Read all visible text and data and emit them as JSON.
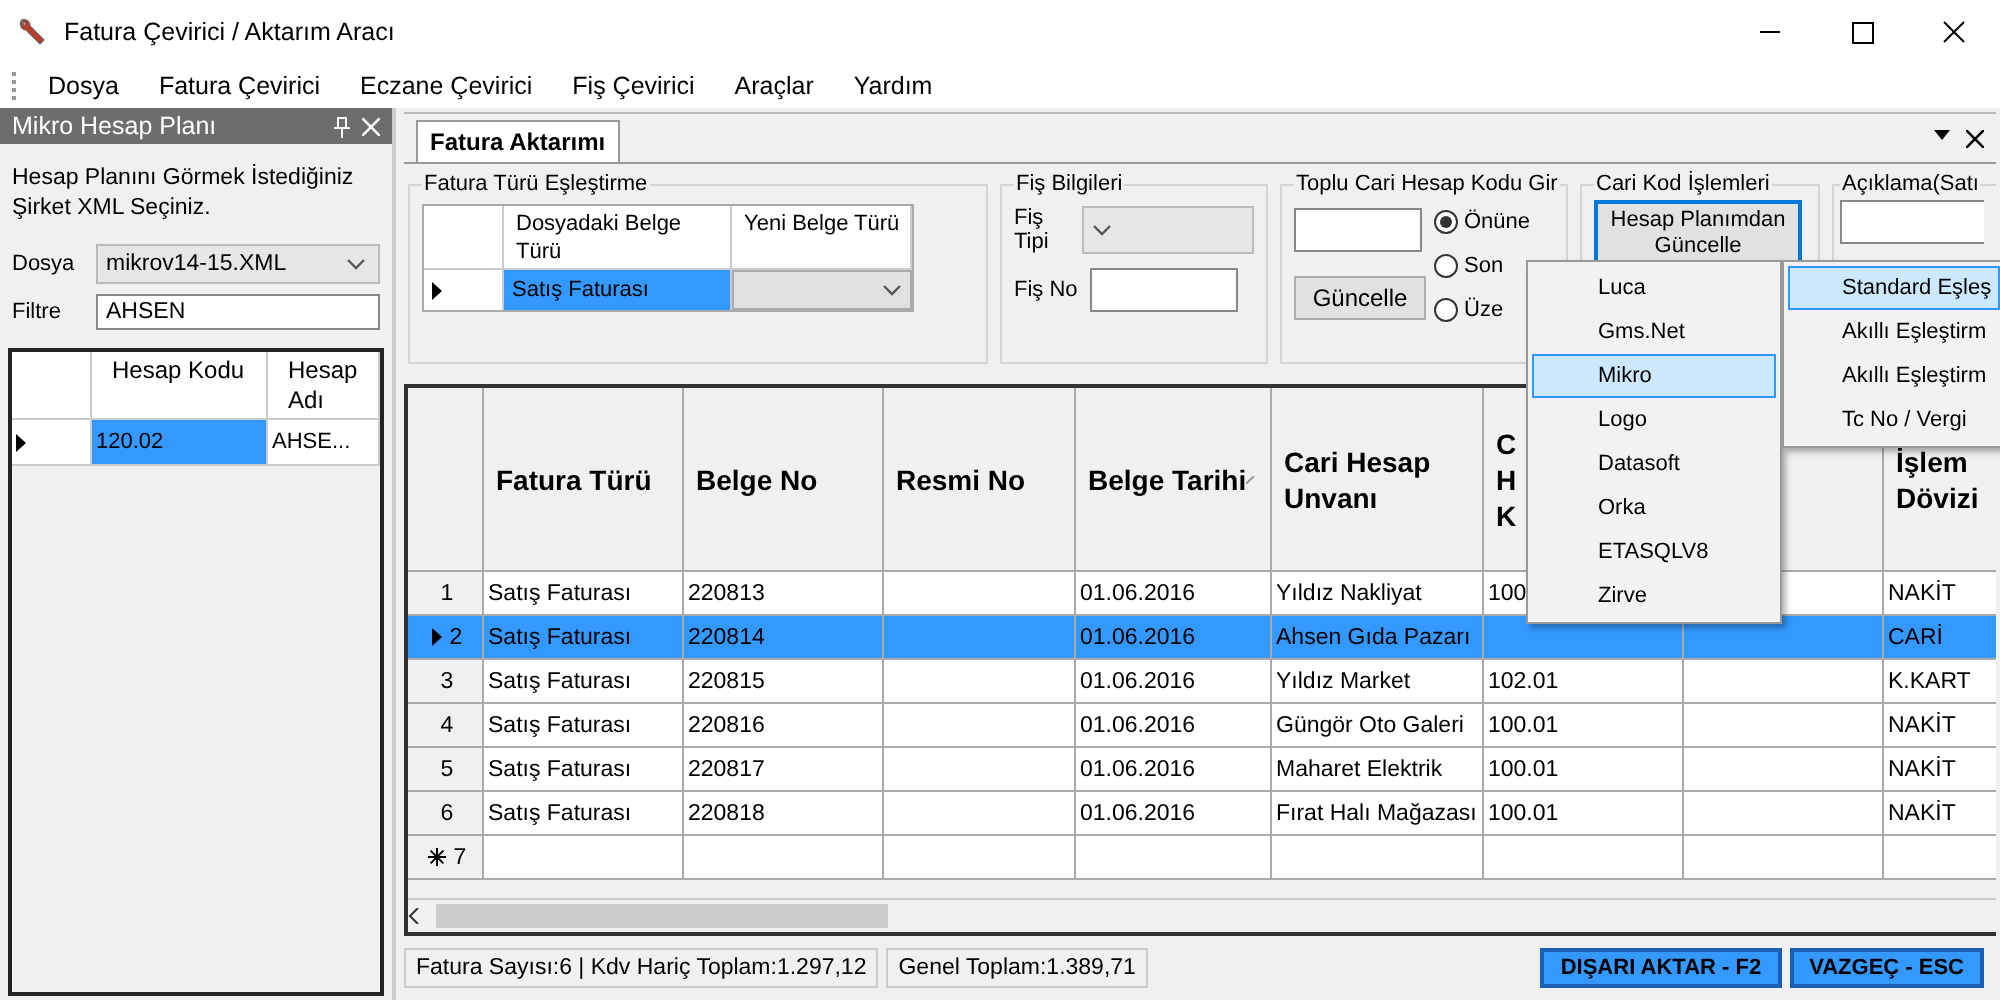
{
  "window": {
    "title": "Fatura Çevirici / Aktarım Aracı"
  },
  "menu": [
    "Dosya",
    "Fatura Çevirici",
    "Eczane Çevirici",
    "Fiş Çevirici",
    "Araçlar",
    "Yardım"
  ],
  "left_panel": {
    "title": "Mikro Hesap Planı",
    "hint": "Hesap Planını Görmek İstediğiniz Şirket XML Seçiniz.",
    "dosya": {
      "label": "Dosya",
      "value": "mikrov14-15.XML"
    },
    "filtre": {
      "label": "Filtre",
      "value": "AHSEN"
    },
    "table": {
      "columns": [
        "Hesap Kodu",
        "Hesap Adı"
      ],
      "rows": [
        {
          "cells": [
            "120.02",
            "AHSE..."
          ],
          "selected": true
        }
      ]
    }
  },
  "tab": {
    "label": "Fatura Aktarımı"
  },
  "mapping": {
    "title": "Fatura Türü Eşleştirme",
    "columns": [
      "Dosyadaki Belge Türü",
      "Yeni Belge Türü"
    ],
    "rows": [
      {
        "cells": [
          "Satış Faturası",
          ""
        ],
        "selected": true
      }
    ]
  },
  "fis": {
    "title": "Fiş Bilgileri",
    "tipi_label": "Fiş Tipi",
    "no_label": "Fiş No"
  },
  "toplu": {
    "title": "Toplu Cari Hesap Kodu Gir",
    "button": "Güncelle",
    "options": [
      {
        "label": "Önüne",
        "selected": true
      },
      {
        "label": "Son",
        "selected": false
      },
      {
        "label": "Üze",
        "selected": false
      }
    ]
  },
  "cari_kod": {
    "title": "Cari Kod İşlemleri",
    "button": "Hesap Planımdan Güncelle"
  },
  "aciklama": {
    "title": "Açıklama(Satı"
  },
  "grid": {
    "columns": [
      "Fatura Türü",
      "Belge No",
      "Resmi No",
      "Belge Tarihi",
      "Cari Hesap Unvanı",
      "C H K",
      "",
      "İşlem Dövizi"
    ],
    "rows": [
      {
        "number": "1",
        "selected": false,
        "cells": [
          "Satış Faturası",
          "220813",
          "",
          "01.06.2016",
          "Yıldız Nakliyat",
          "100",
          "",
          "NAKİT"
        ]
      },
      {
        "number": "2",
        "selected": true,
        "cells": [
          "Satış Faturası",
          "220814",
          "",
          "01.06.2016",
          "Ahsen Gıda Pazarı",
          "",
          "",
          "CARİ"
        ]
      },
      {
        "number": "3",
        "selected": false,
        "cells": [
          "Satış Faturası",
          "220815",
          "",
          "01.06.2016",
          "Yıldız Market",
          "102.01",
          "",
          "K.KART"
        ]
      },
      {
        "number": "4",
        "selected": false,
        "cells": [
          "Satış Faturası",
          "220816",
          "",
          "01.06.2016",
          "Güngör Oto Galeri",
          "100.01",
          "",
          "NAKİT"
        ]
      },
      {
        "number": "5",
        "selected": false,
        "cells": [
          "Satış Faturası",
          "220817",
          "",
          "01.06.2016",
          "Maharet Elektrik",
          "100.01",
          "",
          "NAKİT"
        ]
      },
      {
        "number": "6",
        "selected": false,
        "cells": [
          "Satış Faturası",
          "220818",
          "",
          "01.06.2016",
          "Fırat Halı Mağazası",
          "100.01",
          "",
          "NAKİT"
        ]
      }
    ],
    "new_row": "7"
  },
  "status": [
    "Fatura Sayısı:6 | Kdv Hariç Toplam:1.297,12",
    "Genel Toplam:1.389,71"
  ],
  "buttons": [
    "DIŞARI AKTAR - F2",
    "VAZGEÇ - ESC"
  ],
  "context_menu": {
    "items": [
      {
        "label": "Luca",
        "selected": false
      },
      {
        "label": "Gms.Net",
        "selected": false
      },
      {
        "label": "Mikro",
        "selected": true
      },
      {
        "label": "Logo",
        "selected": false
      },
      {
        "label": "Datasoft",
        "selected": false
      },
      {
        "label": "Orka",
        "selected": false
      },
      {
        "label": "ETASQLV8",
        "selected": false
      },
      {
        "label": "Zirve",
        "selected": false
      }
    ]
  },
  "submenu": {
    "items": [
      {
        "label": "Standard Eşleş",
        "selected": true
      },
      {
        "label": "Akıllı Eşleştirm",
        "selected": false
      },
      {
        "label": "Akıllı Eşleştirm",
        "selected": false
      },
      {
        "label": "Tc No / Vergi",
        "selected": false
      }
    ]
  }
}
